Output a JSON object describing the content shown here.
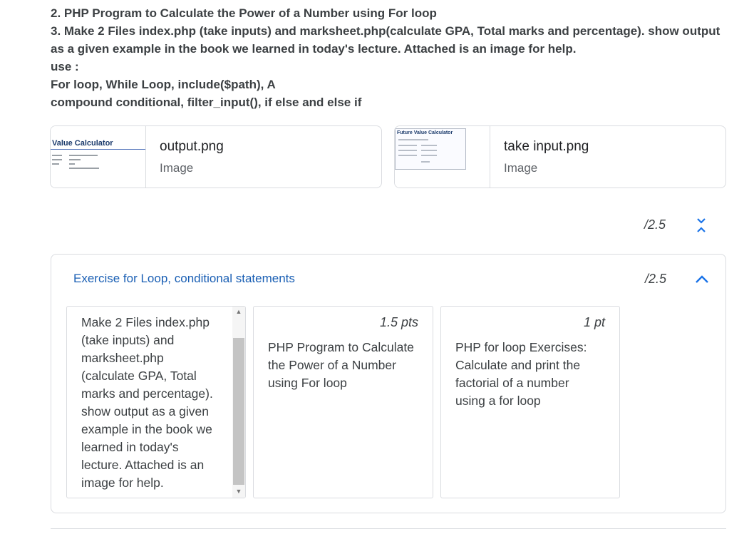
{
  "instructions": {
    "lines": [
      "2. PHP Program to Calculate the Power of a Number using For loop",
      "3. Make 2 Files index.php (take inputs) and marksheet.php(calculate GPA, Total marks and percentage). show output",
      "as a given example in the book we learned in today's lecture.  Attached is an image for help.",
      "use :",
      "For loop, While Loop, include($path),  A",
      "compound conditional, filter_input(), if else and else if"
    ]
  },
  "attachments": [
    {
      "name": "output.png",
      "type": "Image",
      "thumb_title": "Value Calculator"
    },
    {
      "name": "take input.png",
      "type": "Image",
      "thumb_title": "Future Value Calculator"
    }
  ],
  "total_score": "/2.5",
  "rubric": {
    "title": "Exercise for Loop, conditional statements",
    "score": "/2.5",
    "criteria": [
      {
        "points": "",
        "lines": [
          "Make 2 Files index.php",
          "(take inputs) and",
          "marksheet.php",
          "(calculate GPA, Total",
          "marks and percentage).",
          "show output as a given",
          "example in the book we",
          "learned in today's",
          "lecture. Attached is an",
          "image for help."
        ]
      },
      {
        "points": "1.5 pts",
        "lines": [
          "PHP Program to Calculate",
          "the Power of a Number",
          "using For loop"
        ]
      },
      {
        "points": "1 pt",
        "lines": [
          "PHP for loop Exercises:",
          "Calculate and print the",
          "factorial of a number",
          "using a for loop"
        ]
      }
    ]
  },
  "icons": {
    "expand_all": "unfold-icon",
    "collapse": "chevron-up-icon",
    "scroll_up": "chevron-up-icon",
    "scroll_down": "chevron-down-icon"
  },
  "colors": {
    "accent": "#1a73e8",
    "link": "#1a5fb4",
    "border": "#dadce0"
  }
}
